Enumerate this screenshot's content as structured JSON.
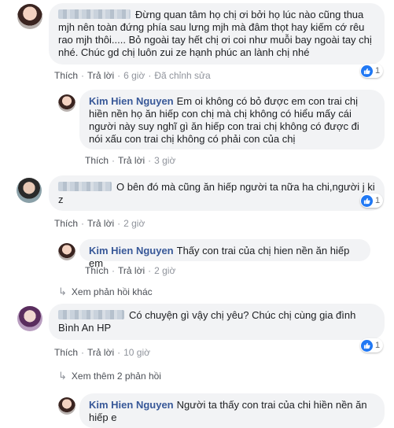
{
  "comments": [
    {
      "text": "Đừng quan tâm họ chị ơi bởi họ lúc nào cũng thua mjh nên toàn đứng phía sau lưng mjh mà đâm thọt hay kiếm cớ rêu rao mjh thôi..... Bỏ ngoài tay hết chị ơi coi như muỗi bay ngoài tay chị nhé. Chúc gd chị luôn zui ze hạnh phúc an lành chị nhé",
      "like": "Thích",
      "reply": "Trả lời",
      "time": "6 giờ",
      "edited": "Đã chỉnh sửa",
      "reactions": "1",
      "reply_comment": {
        "author": "Kim Hien Nguyen",
        "text": "Em oi không có bỏ được em con trai chị hiền nền họ ăn hiếp con chị mà chị không có hiểu mấy cái người này suy nghĩ gì ăn hiếp con trai chị không có được đi nói xấu con trai chị không có phải con của chị",
        "like": "Thích",
        "reply": "Trả lời",
        "time": "3 giờ"
      }
    },
    {
      "text": "O bên đó mà cũng ăn hiếp người ta nữa ha chi,người j ki z",
      "like": "Thích",
      "reply": "Trả lời",
      "time": "2 giờ",
      "reactions": "1",
      "reply_comment": {
        "author": "Kim Hien Nguyen",
        "text": "Thấy con trai của chị hien nền ăn hiếp em",
        "like": "Thích",
        "reply": "Trả lời",
        "time": "2 giờ"
      },
      "more_label": "Xem phản hồi khác"
    },
    {
      "text": "Có chuyện gì vậy chị yêu? Chúc chị cùng gia đình Bình An HP",
      "like": "Thích",
      "reply": "Trả lời",
      "time": "10 giờ",
      "reactions": "1",
      "more_label": "Xem thêm 2 phản hồi",
      "reply_comment": {
        "author": "Kim Hien Nguyen",
        "text": "Người ta thấy con trai của chi hiền nền ăn hiếp e"
      }
    }
  ],
  "colors": {
    "author": "#385898",
    "bubble": "#f2f3f5",
    "like_blue": "#2078f4",
    "meta": "#606770"
  },
  "icons": [
    "like-icon",
    "reply-arrow-icon"
  ]
}
